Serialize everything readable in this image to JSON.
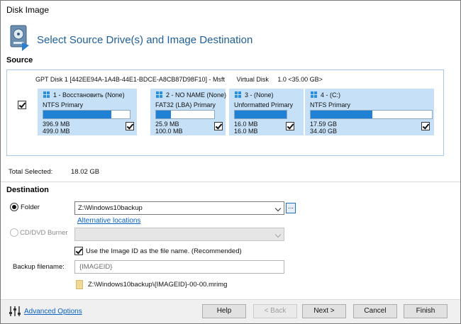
{
  "window": {
    "title": "Disk Image"
  },
  "header": {
    "title": "Select Source Drive(s) and Image Destination"
  },
  "source": {
    "label": "Source",
    "disk": {
      "name": "GPT Disk 1 [442EE94A-1A4B-44E1-BDCE-A8CB87D98F10] - Msft",
      "type": "Virtual Disk",
      "size": "1.0  <35.00 GB>",
      "checked": true
    },
    "partitions": [
      {
        "title": "1 - Восстановить (None)",
        "fs": "NTFS Primary",
        "used": "396.9 MB",
        "total": "499.0 MB",
        "fill": 0.79,
        "checked": true
      },
      {
        "title": "2 - NO NAME (None)",
        "fs": "FAT32 (LBA) Primary",
        "used": "25.9 MB",
        "total": "100.0 MB",
        "fill": 0.26,
        "checked": true
      },
      {
        "title": "3 - (None)",
        "fs": "Unformatted Primary",
        "used": "16.0 MB",
        "total": "16.0 MB",
        "fill": 1.0,
        "checked": true
      },
      {
        "title": "4 - (C:)",
        "fs": "NTFS Primary",
        "used": "17.59 GB",
        "total": "34.40 GB",
        "fill": 0.51,
        "checked": true
      }
    ]
  },
  "totals": {
    "label": "Total Selected:",
    "value": "18.02 GB"
  },
  "destination": {
    "label": "Destination",
    "folder_label": "Folder",
    "folder_value": "Z:\\Windows10backup",
    "browse_label": "...",
    "alt_locations": "Alternative locations",
    "cd_label": "CD/DVD Burner",
    "use_image_id_label": "Use the Image ID as the file name.  (Recommended)",
    "backup_filename_label": "Backup filename:",
    "backup_filename_value": "{IMAGEID}",
    "path_preview": "Z:\\Windows10backup\\{IMAGEID}-00-00.mrimg"
  },
  "footer": {
    "advanced_options": "Advanced Options",
    "help": "Help",
    "back": "< Back",
    "next": "Next >",
    "cancel": "Cancel",
    "finish": "Finish"
  },
  "colors": {
    "accent": "#1e5f99",
    "partition_bg": "#c6e1f7",
    "bar_fill": "#1f80d4",
    "link": "#0b62c4"
  }
}
